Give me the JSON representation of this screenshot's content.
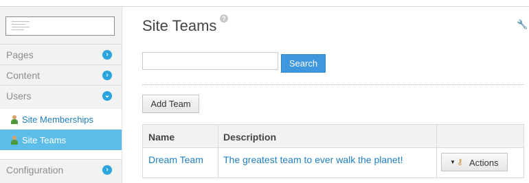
{
  "sidebar": {
    "nav": [
      {
        "label": "Pages",
        "icon": "chevron-right-icon",
        "glyph": "›"
      },
      {
        "label": "Content",
        "icon": "chevron-right-icon",
        "glyph": "›"
      },
      {
        "label": "Users",
        "icon": "chevron-down-icon",
        "glyph": "⌄"
      },
      {
        "label": "Configuration",
        "icon": "chevron-right-icon",
        "glyph": "›"
      }
    ],
    "subitems": [
      {
        "label": "Site Memberships",
        "active": false
      },
      {
        "label": "Site Teams",
        "active": true
      }
    ]
  },
  "main": {
    "title": "Site Teams",
    "help_glyph": "?",
    "wrench_glyph": "🔧",
    "search": {
      "value": "",
      "placeholder": "",
      "button_label": "Search"
    },
    "add_team_label": "Add Team",
    "table": {
      "columns": [
        "Name",
        "Description",
        ""
      ],
      "rows": [
        {
          "name": "Dream Team",
          "description": "The greatest team to ever walk the planet!",
          "action_label": "Actions"
        }
      ]
    }
  },
  "colors": {
    "accent": "#2aa6dc",
    "active_bg": "#5cbde9",
    "link": "#1f7fbf",
    "button_blue": "#3f97e0"
  }
}
